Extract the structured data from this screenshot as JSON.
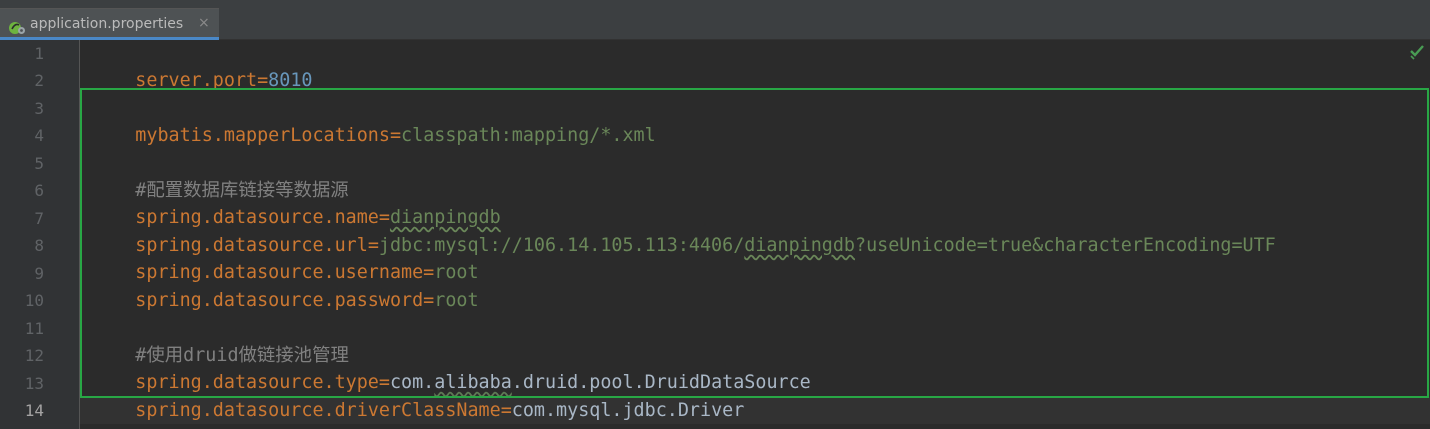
{
  "tab": {
    "label": "application.properties",
    "close": "×",
    "icon": "spring-properties-file-icon"
  },
  "status_icon": "inspection-ok-check-icon",
  "colors": {
    "key": "#cc7832",
    "value": "#6a8759",
    "number": "#6897bb",
    "comment": "#808080",
    "highlight": "#28a745"
  },
  "editor": {
    "line_numbers": [
      "1",
      "2",
      "3",
      "4",
      "5",
      "6",
      "7",
      "8",
      "9",
      "10",
      "11",
      "12",
      "13",
      "14"
    ],
    "lines": [
      {
        "key": "server.port",
        "eq": "=",
        "value": "8010"
      },
      {},
      {
        "key": "mybatis.mapperLocations",
        "eq": "=",
        "value": "classpath:mapping/*.xml"
      },
      {},
      {
        "comment": "#配置数据库链接等数据源"
      },
      {
        "key": "spring.datasource.name",
        "eq": "=",
        "value": "dianpingdb"
      },
      {
        "key": "spring.datasource.url",
        "eq": "=",
        "value_a": "jdbc:mysql://106.14.105.113:4406/",
        "value_b": "dianpingdb",
        "value_c": "?useUnicode=true&characterEncoding=UTF"
      },
      {
        "key": "spring.datasource.username",
        "eq": "=",
        "value": "root"
      },
      {
        "key": "spring.datasource.password",
        "eq": "=",
        "value": "root"
      },
      {},
      {
        "comment": "#使用druid做链接池管理"
      },
      {
        "key": "spring.datasource.type",
        "eq": "=",
        "value_a": "com.",
        "value_b": "alibaba",
        "value_c": ".druid.pool.DruidDataSource"
      },
      {
        "key": "spring.datasource.driverClassName",
        "eq": "=",
        "value": "com.mysql.jdbc.Driver"
      },
      {}
    ]
  }
}
